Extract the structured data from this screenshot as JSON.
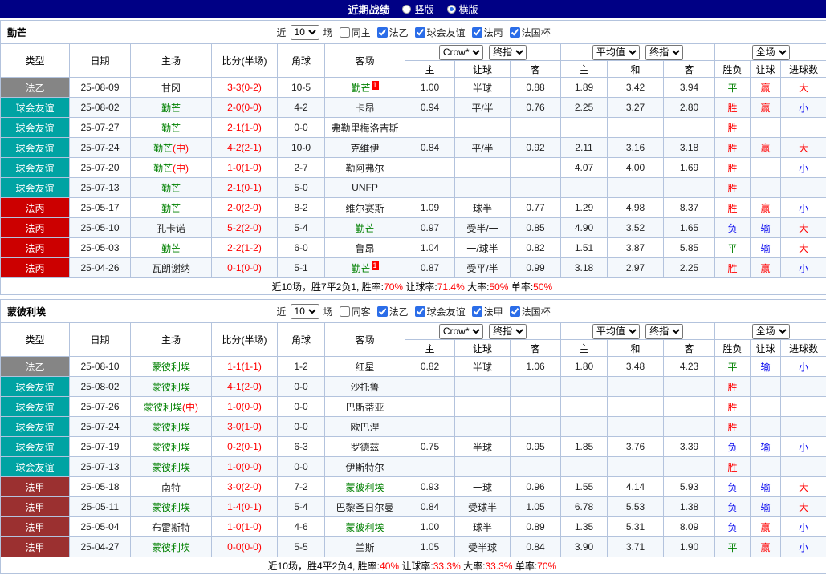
{
  "titlebar": {
    "title": "近期战绩",
    "layout_options": [
      {
        "label": "竖版",
        "selected": false
      },
      {
        "label": "横版",
        "selected": true
      }
    ]
  },
  "colors": {
    "c-red": "#ff0000",
    "c-blue": "#0000ee",
    "c-green": "#008000",
    "navy": "#000085",
    "border": "#b3c3dd",
    "accent": "#2b6de8",
    "lg-gray": "#858585",
    "lg-teal": "#00a3a3",
    "lg-red": "#cc0000",
    "lg-maroon": "#9b3030"
  },
  "col_headers": [
    "类型",
    "日期",
    "主场",
    "比分(半场)",
    "角球",
    "客场",
    "主",
    "让球",
    "客",
    "主",
    "和",
    "客",
    "胜负",
    "让球",
    "进球数"
  ],
  "selects": {
    "odds_company": "Crow*",
    "odds_stage": "终指",
    "avg_label": "平均值",
    "avg_stage": "终指",
    "scope": "全场"
  },
  "sections": [
    {
      "team": "勤芒",
      "filter": {
        "near": "近",
        "count": "10",
        "games": "场",
        "same": "同主",
        "same_checked": false,
        "leagues": [
          {
            "label": "法乙",
            "checked": true
          },
          {
            "label": "球会友谊",
            "checked": true
          },
          {
            "label": "法丙",
            "checked": true
          },
          {
            "label": "法国杯",
            "checked": true
          }
        ]
      },
      "rows": [
        {
          "league": "法乙",
          "league_c": "gray",
          "date": "25-08-09",
          "home": {
            "name": "甘冈"
          },
          "score": "3-3(0-2)",
          "corners": "10-5",
          "away": {
            "name": "勤芒",
            "self": true,
            "sup": "1"
          },
          "hcap": [
            "1.00",
            "半球",
            "0.88"
          ],
          "euro": [
            "1.89",
            "3.42",
            "3.94"
          ],
          "res": [
            {
              "t": "平",
              "c": "green"
            },
            {
              "t": "赢",
              "c": "red"
            },
            {
              "t": "大",
              "c": "red"
            }
          ]
        },
        {
          "league": "球会友谊",
          "league_c": "teal",
          "date": "25-08-02",
          "home": {
            "name": "勤芒",
            "self": true
          },
          "score": "2-0(0-0)",
          "corners": "4-2",
          "away": {
            "name": "卡昂"
          },
          "hcap": [
            "0.94",
            "平/半",
            "0.76"
          ],
          "euro": [
            "2.25",
            "3.27",
            "2.80"
          ],
          "res": [
            {
              "t": "胜",
              "c": "red"
            },
            {
              "t": "赢",
              "c": "red"
            },
            {
              "t": "小",
              "c": "blue"
            }
          ]
        },
        {
          "league": "球会友谊",
          "league_c": "teal",
          "date": "25-07-27",
          "home": {
            "name": "勤芒",
            "self": true
          },
          "score": "2-1(1-0)",
          "corners": "0-0",
          "away": {
            "name": "弗勒里梅洛吉斯"
          },
          "hcap": [
            "",
            "",
            ""
          ],
          "euro": [
            "",
            "",
            ""
          ],
          "res": [
            {
              "t": "胜",
              "c": "red"
            },
            {
              "t": ""
            },
            {
              "t": ""
            }
          ]
        },
        {
          "league": "球会友谊",
          "league_c": "teal",
          "date": "25-07-24",
          "home": {
            "name": "勤芒",
            "self": true,
            "mid": true
          },
          "score": "4-2(2-1)",
          "corners": "10-0",
          "away": {
            "name": "克维伊"
          },
          "hcap": [
            "0.84",
            "平/半",
            "0.92"
          ],
          "euro": [
            "2.11",
            "3.16",
            "3.18"
          ],
          "res": [
            {
              "t": "胜",
              "c": "red"
            },
            {
              "t": "赢",
              "c": "red"
            },
            {
              "t": "大",
              "c": "red"
            }
          ]
        },
        {
          "league": "球会友谊",
          "league_c": "teal",
          "date": "25-07-20",
          "home": {
            "name": "勤芒",
            "self": true,
            "mid": true
          },
          "score": "1-0(1-0)",
          "corners": "2-7",
          "away": {
            "name": "勒阿弗尔"
          },
          "hcap": [
            "",
            "",
            ""
          ],
          "euro": [
            "4.07",
            "4.00",
            "1.69"
          ],
          "res": [
            {
              "t": "胜",
              "c": "red"
            },
            {
              "t": ""
            },
            {
              "t": "小",
              "c": "blue"
            }
          ]
        },
        {
          "league": "球会友谊",
          "league_c": "teal",
          "date": "25-07-13",
          "home": {
            "name": "勤芒",
            "self": true
          },
          "score": "2-1(0-1)",
          "corners": "5-0",
          "away": {
            "name": "UNFP"
          },
          "hcap": [
            "",
            "",
            ""
          ],
          "euro": [
            "",
            "",
            ""
          ],
          "res": [
            {
              "t": "胜",
              "c": "red"
            },
            {
              "t": ""
            },
            {
              "t": ""
            }
          ]
        },
        {
          "league": "法丙",
          "league_c": "red",
          "date": "25-05-17",
          "home": {
            "name": "勤芒",
            "self": true
          },
          "score": "2-0(2-0)",
          "corners": "8-2",
          "away": {
            "name": "维尔赛斯"
          },
          "hcap": [
            "1.09",
            "球半",
            "0.77"
          ],
          "euro": [
            "1.29",
            "4.98",
            "8.37"
          ],
          "res": [
            {
              "t": "胜",
              "c": "red"
            },
            {
              "t": "赢",
              "c": "red"
            },
            {
              "t": "小",
              "c": "blue"
            }
          ]
        },
        {
          "league": "法丙",
          "league_c": "red",
          "date": "25-05-10",
          "home": {
            "name": "孔卡诺"
          },
          "score": "5-2(2-0)",
          "corners": "5-4",
          "away": {
            "name": "勤芒",
            "self": true
          },
          "hcap": [
            "0.97",
            "受半/一",
            "0.85"
          ],
          "euro": [
            "4.90",
            "3.52",
            "1.65"
          ],
          "res": [
            {
              "t": "负",
              "c": "blue"
            },
            {
              "t": "输",
              "c": "blue"
            },
            {
              "t": "大",
              "c": "red"
            }
          ]
        },
        {
          "league": "法丙",
          "league_c": "red",
          "date": "25-05-03",
          "home": {
            "name": "勤芒",
            "self": true
          },
          "score": "2-2(1-2)",
          "corners": "6-0",
          "away": {
            "name": "鲁昂"
          },
          "hcap": [
            "1.04",
            "一/球半",
            "0.82"
          ],
          "euro": [
            "1.51",
            "3.87",
            "5.85"
          ],
          "res": [
            {
              "t": "平",
              "c": "green"
            },
            {
              "t": "输",
              "c": "blue"
            },
            {
              "t": "大",
              "c": "red"
            }
          ]
        },
        {
          "league": "法丙",
          "league_c": "red",
          "date": "25-04-26",
          "home": {
            "name": "瓦朗谢纳"
          },
          "score": "0-1(0-0)",
          "corners": "5-1",
          "away": {
            "name": "勤芒",
            "self": true,
            "sup": "1"
          },
          "hcap": [
            "0.87",
            "受平/半",
            "0.99"
          ],
          "euro": [
            "3.18",
            "2.97",
            "2.25"
          ],
          "res": [
            {
              "t": "胜",
              "c": "red"
            },
            {
              "t": "赢",
              "c": "red"
            },
            {
              "t": "小",
              "c": "blue"
            }
          ]
        }
      ],
      "summary": {
        "prefix": "近10场，胜7平2负1, ",
        "stats": [
          {
            "label": "胜率:",
            "value": "70%"
          },
          {
            "label": "让球率:",
            "value": "71.4%"
          },
          {
            "label": "大率:",
            "value": "50%"
          },
          {
            "label": "单率:",
            "value": "50%"
          }
        ]
      }
    },
    {
      "team": "蒙彼利埃",
      "filter": {
        "near": "近",
        "count": "10",
        "games": "场",
        "same": "同客",
        "same_checked": false,
        "leagues": [
          {
            "label": "法乙",
            "checked": true
          },
          {
            "label": "球会友谊",
            "checked": true
          },
          {
            "label": "法甲",
            "checked": true
          },
          {
            "label": "法国杯",
            "checked": true
          }
        ]
      },
      "rows": [
        {
          "league": "法乙",
          "league_c": "gray",
          "date": "25-08-10",
          "home": {
            "name": "蒙彼利埃",
            "self": true
          },
          "score": "1-1(1-1)",
          "corners": "1-2",
          "away": {
            "name": "红星"
          },
          "hcap": [
            "0.82",
            "半球",
            "1.06"
          ],
          "euro": [
            "1.80",
            "3.48",
            "4.23"
          ],
          "res": [
            {
              "t": "平",
              "c": "green"
            },
            {
              "t": "输",
              "c": "blue"
            },
            {
              "t": "小",
              "c": "blue"
            }
          ]
        },
        {
          "league": "球会友谊",
          "league_c": "teal",
          "date": "25-08-02",
          "home": {
            "name": "蒙彼利埃",
            "self": true
          },
          "score": "4-1(2-0)",
          "corners": "0-0",
          "away": {
            "name": "沙托鲁"
          },
          "hcap": [
            "",
            "",
            ""
          ],
          "euro": [
            "",
            "",
            ""
          ],
          "res": [
            {
              "t": "胜",
              "c": "red"
            },
            {
              "t": ""
            },
            {
              "t": ""
            }
          ]
        },
        {
          "league": "球会友谊",
          "league_c": "teal",
          "date": "25-07-26",
          "home": {
            "name": "蒙彼利埃",
            "self": true,
            "mid": true
          },
          "score": "1-0(0-0)",
          "corners": "0-0",
          "away": {
            "name": "巴斯蒂亚"
          },
          "hcap": [
            "",
            "",
            ""
          ],
          "euro": [
            "",
            "",
            ""
          ],
          "res": [
            {
              "t": "胜",
              "c": "red"
            },
            {
              "t": ""
            },
            {
              "t": ""
            }
          ]
        },
        {
          "league": "球会友谊",
          "league_c": "teal",
          "date": "25-07-24",
          "home": {
            "name": "蒙彼利埃",
            "self": true
          },
          "score": "3-0(1-0)",
          "corners": "0-0",
          "away": {
            "name": "欧巴涅"
          },
          "hcap": [
            "",
            "",
            ""
          ],
          "euro": [
            "",
            "",
            ""
          ],
          "res": [
            {
              "t": "胜",
              "c": "red"
            },
            {
              "t": ""
            },
            {
              "t": ""
            }
          ]
        },
        {
          "league": "球会友谊",
          "league_c": "teal",
          "date": "25-07-19",
          "home": {
            "name": "蒙彼利埃",
            "self": true
          },
          "score": "0-2(0-1)",
          "corners": "6-3",
          "away": {
            "name": "罗德兹"
          },
          "hcap": [
            "0.75",
            "半球",
            "0.95"
          ],
          "euro": [
            "1.85",
            "3.76",
            "3.39"
          ],
          "res": [
            {
              "t": "负",
              "c": "blue"
            },
            {
              "t": "输",
              "c": "blue"
            },
            {
              "t": "小",
              "c": "blue"
            }
          ]
        },
        {
          "league": "球会友谊",
          "league_c": "teal",
          "date": "25-07-13",
          "home": {
            "name": "蒙彼利埃",
            "self": true
          },
          "score": "1-0(0-0)",
          "corners": "0-0",
          "away": {
            "name": "伊斯特尔"
          },
          "hcap": [
            "",
            "",
            ""
          ],
          "euro": [
            "",
            "",
            ""
          ],
          "res": [
            {
              "t": "胜",
              "c": "red"
            },
            {
              "t": ""
            },
            {
              "t": ""
            }
          ]
        },
        {
          "league": "法甲",
          "league_c": "maroon",
          "date": "25-05-18",
          "home": {
            "name": "南特"
          },
          "score": "3-0(2-0)",
          "corners": "7-2",
          "away": {
            "name": "蒙彼利埃",
            "self": true
          },
          "hcap": [
            "0.93",
            "一球",
            "0.96"
          ],
          "euro": [
            "1.55",
            "4.14",
            "5.93"
          ],
          "res": [
            {
              "t": "负",
              "c": "blue"
            },
            {
              "t": "输",
              "c": "blue"
            },
            {
              "t": "大",
              "c": "red"
            }
          ]
        },
        {
          "league": "法甲",
          "league_c": "maroon",
          "date": "25-05-11",
          "home": {
            "name": "蒙彼利埃",
            "self": true
          },
          "score": "1-4(0-1)",
          "corners": "5-4",
          "away": {
            "name": "巴黎圣日尔曼"
          },
          "hcap": [
            "0.84",
            "受球半",
            "1.05"
          ],
          "euro": [
            "6.78",
            "5.53",
            "1.38"
          ],
          "res": [
            {
              "t": "负",
              "c": "blue"
            },
            {
              "t": "输",
              "c": "blue"
            },
            {
              "t": "大",
              "c": "red"
            }
          ]
        },
        {
          "league": "法甲",
          "league_c": "maroon",
          "date": "25-05-04",
          "home": {
            "name": "布雷斯特"
          },
          "score": "1-0(1-0)",
          "corners": "4-6",
          "away": {
            "name": "蒙彼利埃",
            "self": true
          },
          "hcap": [
            "1.00",
            "球半",
            "0.89"
          ],
          "euro": [
            "1.35",
            "5.31",
            "8.09"
          ],
          "res": [
            {
              "t": "负",
              "c": "blue"
            },
            {
              "t": "赢",
              "c": "red"
            },
            {
              "t": "小",
              "c": "blue"
            }
          ]
        },
        {
          "league": "法甲",
          "league_c": "maroon",
          "date": "25-04-27",
          "home": {
            "name": "蒙彼利埃",
            "self": true
          },
          "score": "0-0(0-0)",
          "corners": "5-5",
          "away": {
            "name": "兰斯"
          },
          "hcap": [
            "1.05",
            "受半球",
            "0.84"
          ],
          "euro": [
            "3.90",
            "3.71",
            "1.90"
          ],
          "res": [
            {
              "t": "平",
              "c": "green"
            },
            {
              "t": "赢",
              "c": "red"
            },
            {
              "t": "小",
              "c": "blue"
            }
          ]
        }
      ],
      "summary": {
        "prefix": "近10场，胜4平2负4, ",
        "stats": [
          {
            "label": "胜率:",
            "value": "40%"
          },
          {
            "label": "让球率:",
            "value": "33.3%"
          },
          {
            "label": "大率:",
            "value": "33.3%"
          },
          {
            "label": "单率:",
            "value": "70%"
          }
        ]
      }
    }
  ]
}
